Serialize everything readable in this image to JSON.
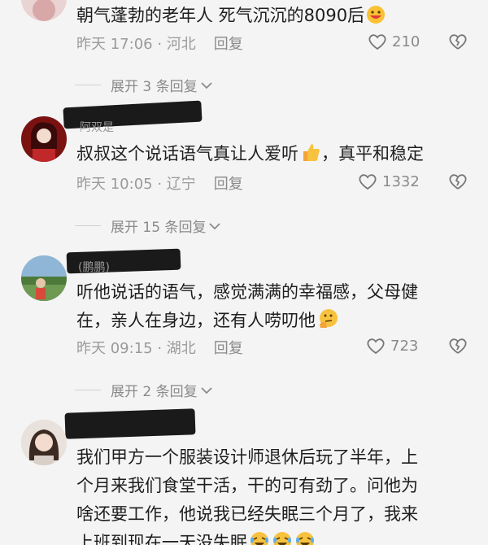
{
  "comments": [
    {
      "text": "朝气蓬勃的老年人  死气沉沉的8090后",
      "time": "昨天 17:06 · 河北",
      "reply": "回复",
      "likes": "210",
      "emoji": "grinning-face-emoji"
    },
    {
      "name_ghost": "阿双是",
      "text": "叔叔这个说话语气真让人爱听",
      "text_after": "，真平和稳定",
      "time": "昨天 10:05 · 辽宁",
      "reply": "回复",
      "likes": "1332",
      "emoji": "thumbs-up-emoji"
    },
    {
      "name_ghost": "(鹏鹏)",
      "line1": "听他说话的语气，感觉满满的幸福感，父母健",
      "line2": "在，亲人在身边，还有人唠叨他",
      "time": "昨天 09:15 · 湖北",
      "reply": "回复",
      "likes": "723",
      "emoji": "thinking-face-emoji"
    },
    {
      "line1": "我们甲方一个服装设计师退休后玩了半年，上",
      "line2": "个月来我们食堂干活，干的可有劲了。问他为",
      "line3": "啥还要工作，他说我已经失眠三个月了，我来",
      "line4": "上班到现在一天没失眠",
      "emoji": "rolling-laughing-emoji"
    }
  ],
  "expanders": [
    {
      "label": "展开 3 条回复"
    },
    {
      "label": "展开 15 条回复"
    },
    {
      "label": "展开 2 条回复"
    }
  ],
  "colors": {
    "background": "#f4f4f4",
    "meta": "#9a9a9a",
    "text": "#1e1e1e"
  }
}
